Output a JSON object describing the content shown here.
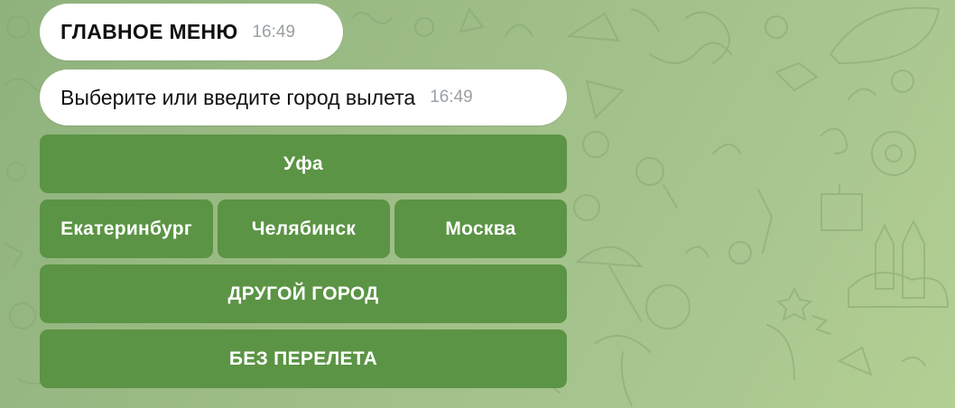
{
  "messages": [
    {
      "text": "ГЛАВНОЕ МЕНЮ",
      "time": "16:49"
    },
    {
      "text": "Выберите или введите город вылета",
      "time": "16:49"
    }
  ],
  "keyboard": {
    "rows": [
      [
        "Уфа"
      ],
      [
        "Екатеринбург",
        "Челябинск",
        "Москва"
      ],
      [
        "ДРУГОЙ ГОРОД"
      ],
      [
        "БЕЗ ПЕРЕЛЕТА"
      ]
    ]
  },
  "colors": {
    "background": "#9dbc86",
    "button": "#5b9445",
    "bubble": "#ffffff",
    "timestamp": "#9aa0a4"
  }
}
